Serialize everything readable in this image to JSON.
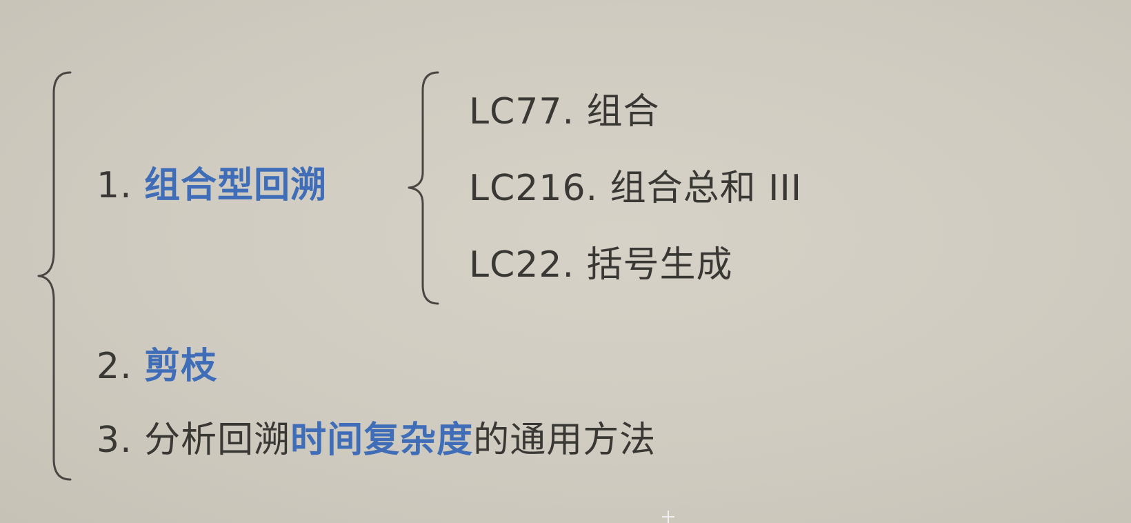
{
  "outline": {
    "item1": {
      "number": "1. ",
      "highlight": "组合型回溯",
      "children": [
        {
          "label": "LC77. 组合"
        },
        {
          "label": "LC216. 组合总和 III"
        },
        {
          "label": "LC22. 括号生成"
        }
      ]
    },
    "item2": {
      "number": "2. ",
      "highlight": "剪枝"
    },
    "item3": {
      "number": "3. ",
      "prefix": "分析回溯",
      "highlight": "时间复杂度",
      "suffix": "的通用方法"
    }
  },
  "colors": {
    "highlight": "#3f6db8",
    "text": "#3a3834",
    "background": "#d2cec3"
  }
}
